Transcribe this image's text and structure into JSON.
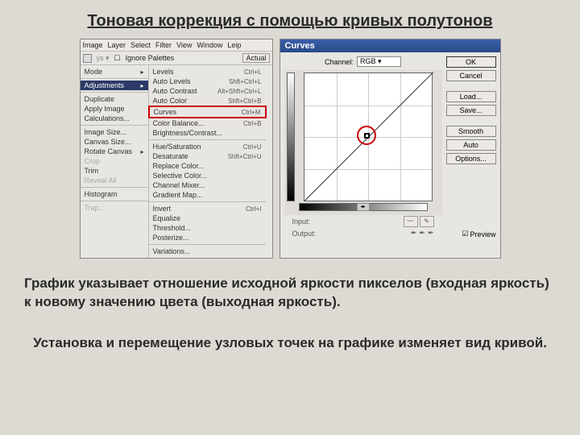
{
  "title": "Тоновая коррекция с помощью кривых полутонов",
  "menubar": [
    "Image",
    "Layer",
    "Select",
    "Filter",
    "View",
    "Window",
    "Leip"
  ],
  "toolbar": {
    "ignore": "Ignore Palettes",
    "actual": "Actual"
  },
  "leftMenu": {
    "mode": "Mode",
    "adjustments": "Adjustments",
    "duplicate": "Duplicate",
    "apply": "Apply Image",
    "calc": "Calculations...",
    "imgsize": "Image Size...",
    "canvassize": "Canvas Size...",
    "rotate": "Rotate Canvas",
    "crop": "Crop",
    "trim": "Trim",
    "reveal": "Reveal All",
    "histogram": "Histogram",
    "trap": "Trap..."
  },
  "rightMenu": {
    "levels": {
      "l": "Levels",
      "s": "Ctrl+L"
    },
    "autolevels": {
      "l": "Auto Levels",
      "s": "Shft+Ctrl+L"
    },
    "autocontrast": {
      "l": "Auto Contrast",
      "s": "Alt+Shft+Ctrl+L"
    },
    "autocolor": {
      "l": "Auto Color",
      "s": "Shft+Ctrl+B"
    },
    "curves": {
      "l": "Curves",
      "s": "Ctrl+M"
    },
    "colorbal": {
      "l": "Color Balance...",
      "s": "Ctrl+B"
    },
    "brightness": {
      "l": "Brightness/Contrast...",
      "s": ""
    },
    "huesat": {
      "l": "Hue/Saturation",
      "s": "Ctrl+U"
    },
    "desat": {
      "l": "Desaturate",
      "s": "Shft+Ctrl+U"
    },
    "replace": {
      "l": "Replace Color...",
      "s": ""
    },
    "selective": {
      "l": "Selective Color...",
      "s": ""
    },
    "chmixer": {
      "l": "Channel Mixer...",
      "s": ""
    },
    "gradmap": {
      "l": "Gradient Map...",
      "s": ""
    },
    "invert": {
      "l": "Invert",
      "s": "Ctrl+I"
    },
    "equalize": {
      "l": "Equalize",
      "s": ""
    },
    "threshold": {
      "l": "Threshold...",
      "s": ""
    },
    "posterize": {
      "l": "Posterize...",
      "s": ""
    },
    "variations": {
      "l": "Variations...",
      "s": ""
    }
  },
  "curves": {
    "title": "Curves",
    "channel_label": "Channel:",
    "channel_value": "RGB",
    "input": "Input:",
    "output": "Output:",
    "ok": "OK",
    "cancel": "Cancel",
    "load": "Load...",
    "save": "Save...",
    "smooth": "Smooth",
    "auto": "Auto",
    "options": "Options...",
    "preview": "Preview"
  },
  "caption1": "График указывает отношение исходной яркости пикселов (входная яркость) к новому значению цвета (выходная яркость).",
  "caption2": "Установка и перемещение узловых точек на графике изменяет вид кривой."
}
